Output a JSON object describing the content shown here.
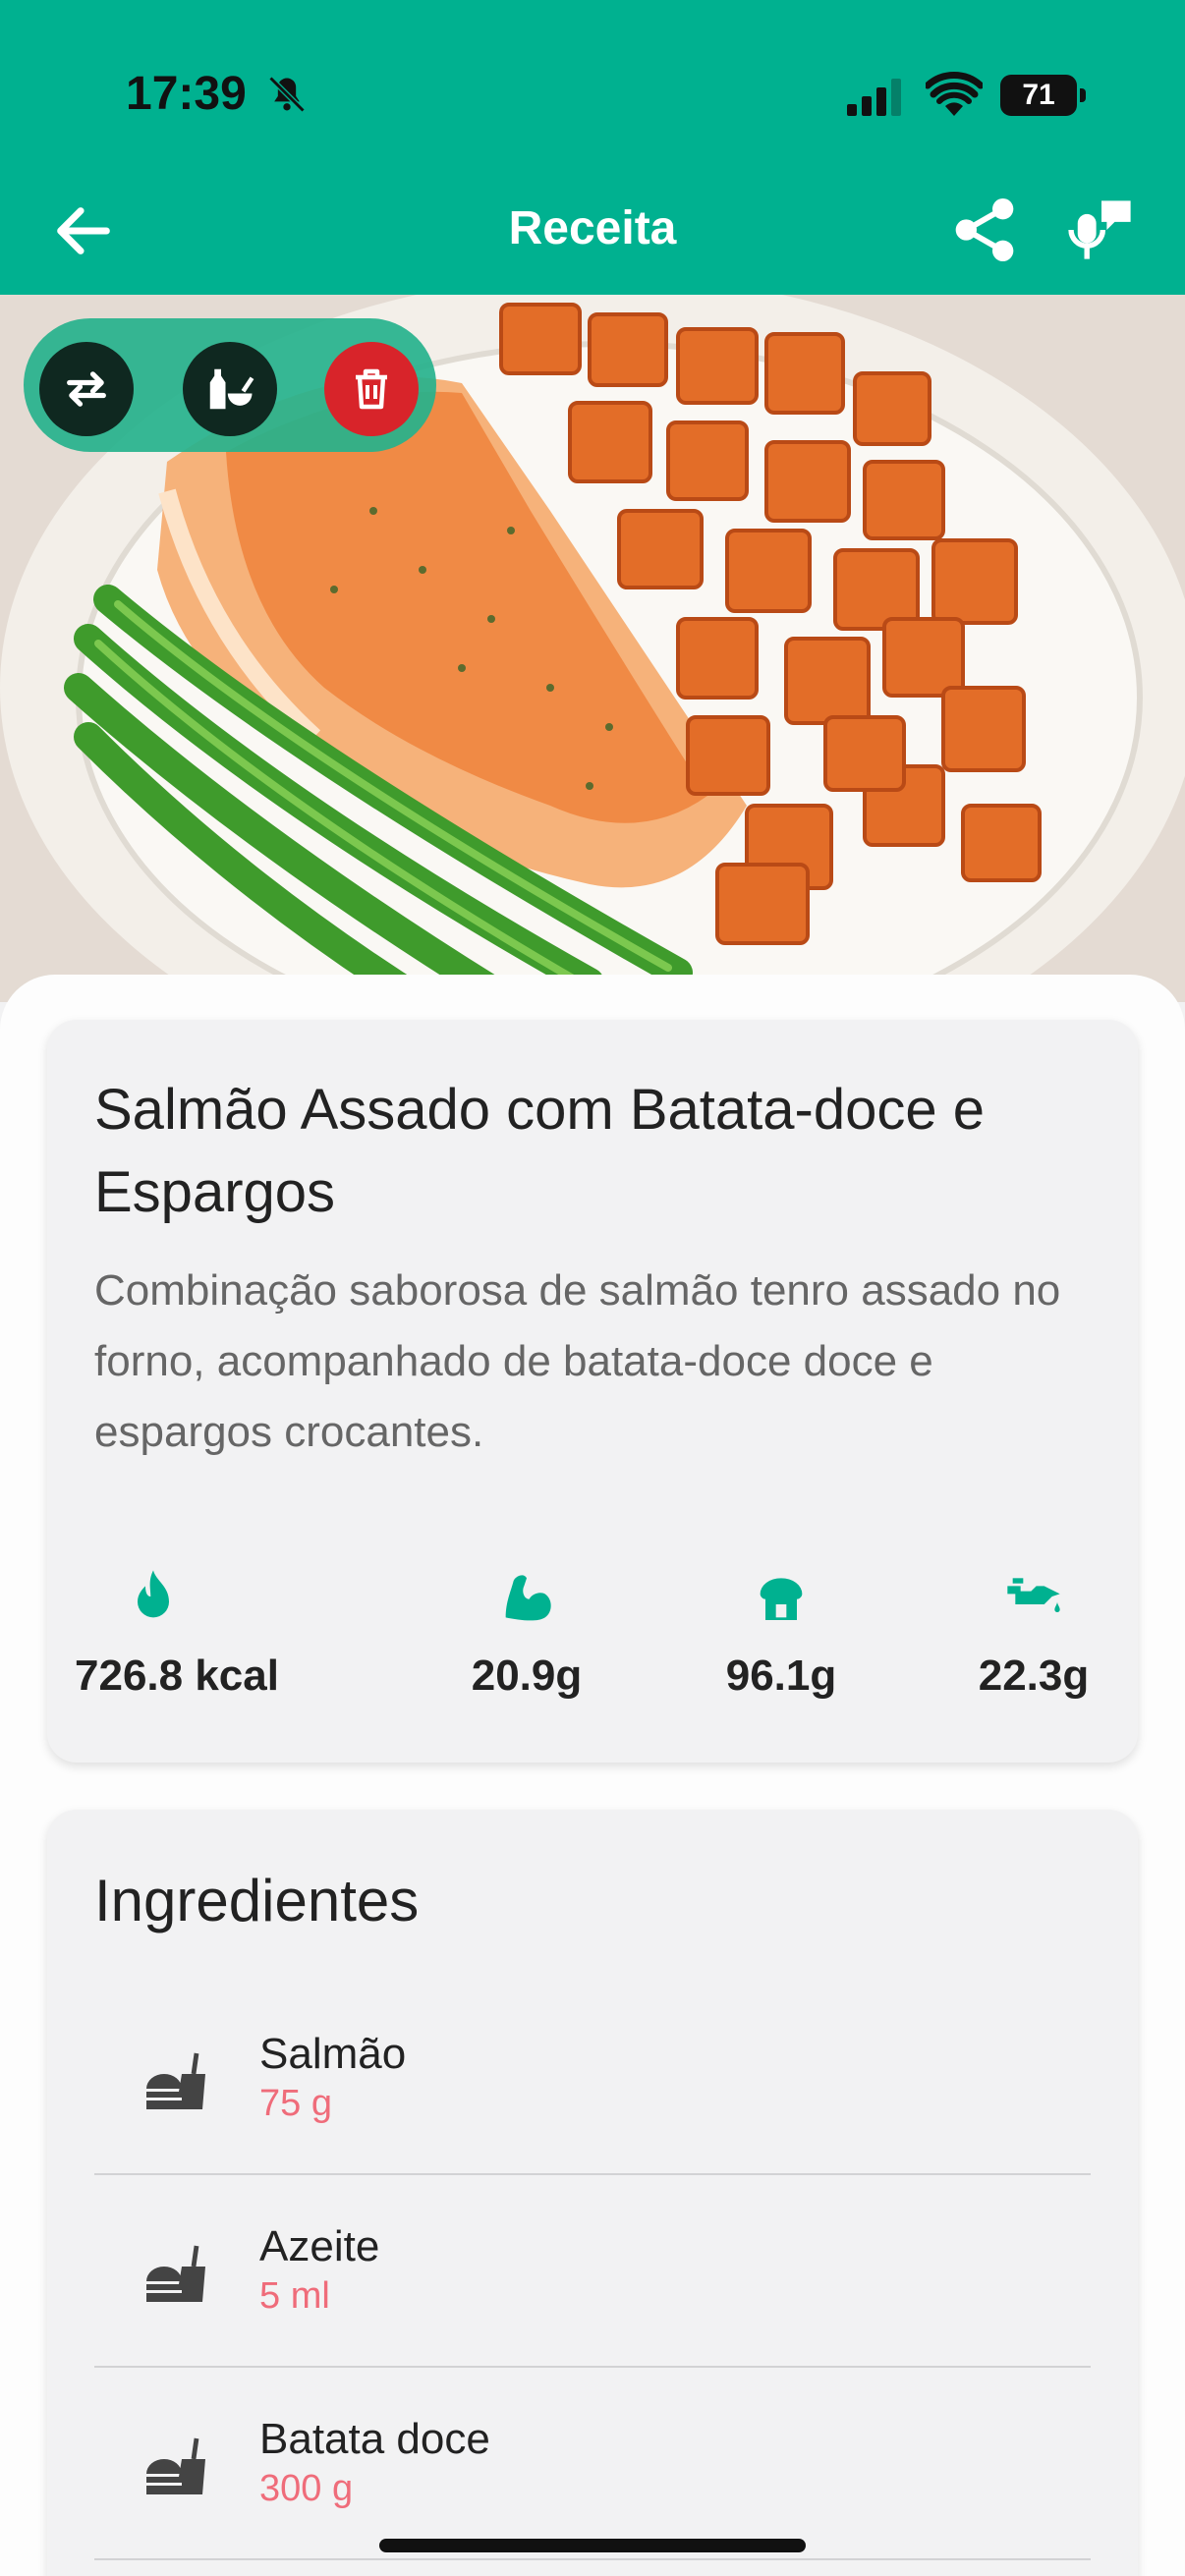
{
  "status_bar": {
    "time": "17:39",
    "battery": "71"
  },
  "header": {
    "title": "Receita"
  },
  "hero": {
    "image": "salmon-sweet-potato-asparagus-plate"
  },
  "recipe": {
    "title": "Salmão Assado com Batata-doce e Espargos",
    "description": "Combinação saborosa de salmão tenro assado no forno, acompanhado de batata-doce doce e espargos crocantes.",
    "macros": [
      {
        "icon": "flame-icon",
        "value": "726.8 kcal"
      },
      {
        "icon": "muscle-icon",
        "value": "20.9g"
      },
      {
        "icon": "bread-icon",
        "value": "96.1g"
      },
      {
        "icon": "oil-can-icon",
        "value": "22.3g"
      }
    ]
  },
  "ingredients": {
    "title": "Ingredientes",
    "items": [
      {
        "name": "Salmão",
        "quantity": "75 g"
      },
      {
        "name": "Azeite",
        "quantity": "5 ml"
      },
      {
        "name": "Batata doce",
        "quantity": "300 g"
      }
    ]
  },
  "colors": {
    "primary": "#00b190",
    "delete": "#d8242a",
    "quantity": "#ef6c7a",
    "card": "#f2f2f3"
  }
}
